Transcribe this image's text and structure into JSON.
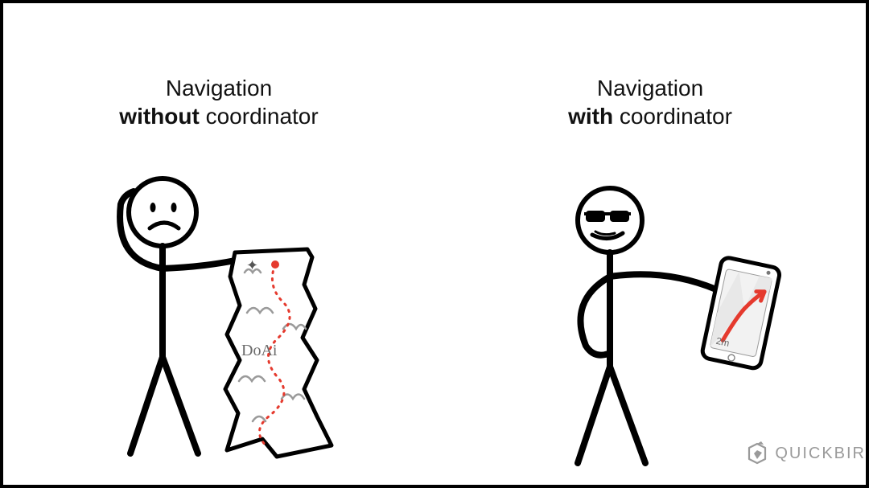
{
  "left": {
    "title_line1": "Navigation",
    "title_emph": "without",
    "title_line2_rest": " coordinator",
    "map_markings": "DoAi"
  },
  "right": {
    "title_line1": "Navigation",
    "title_emph": "with",
    "title_line2_rest": " coordinator",
    "phone_distance": "2m"
  },
  "logo_text": "QUICKBIR",
  "colors": {
    "stroke": "#000000",
    "route": "#e53a2e",
    "map_detail": "#9a9a9a",
    "logo": "#9a9a9a"
  }
}
